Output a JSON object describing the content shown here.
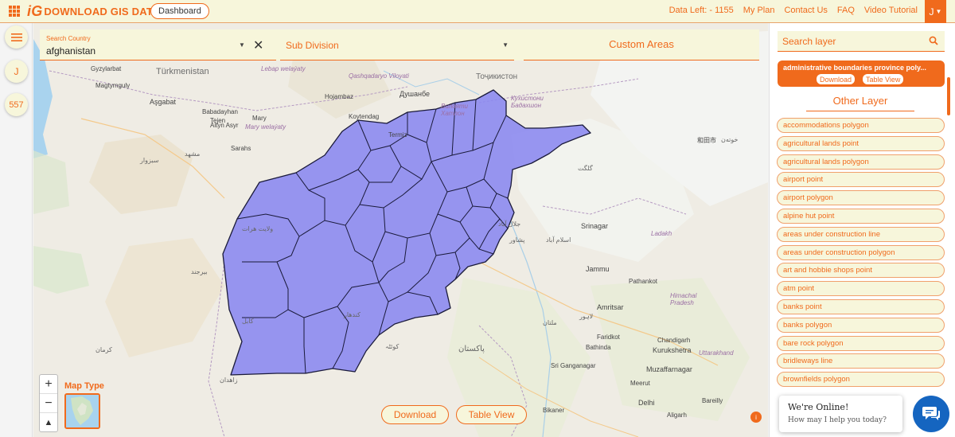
{
  "header": {
    "logo_mark": "iG",
    "logo_text": "DOWNLOAD GIS DATA",
    "dashboard": "Dashboard",
    "data_left": "Data Left: - 1155",
    "links": [
      "My Plan",
      "Contact Us",
      "FAQ",
      "Video Tutorial"
    ],
    "user_initial": "J"
  },
  "leftrail": {
    "user_initial": "J",
    "count": "557"
  },
  "search": {
    "country_label": "Search Country",
    "country_value": "afghanistan",
    "subdivision": "Sub Division",
    "custom_areas": "Custom Areas"
  },
  "map": {
    "map_type_label": "Map Type",
    "download_btn": "Download",
    "table_view_btn": "Table View",
    "zoom_in": "+",
    "zoom_out": "−",
    "reset_north": "▲",
    "labels": {
      "gyzylarbat": "Gyzylarbat",
      "turkmenistan": "Türkmenistan",
      "magtymguly": "Magtymguly",
      "ashgabat": "Aşgabat",
      "babadayhan": "Babadayhan",
      "tejen": "Tejen",
      "altyn_asyr": "Altyn Asyr",
      "mary": "Mary",
      "mary_welayaty": "Mary welaýaty",
      "sarahs": "Sarahs",
      "lebap": "Lebap welaýaty",
      "qashqadaryo": "Qashqadaryo Viloyati",
      "hojambaz": "Hojambaz",
      "koytendag": "Koytendag",
      "termiz": "Termiz",
      "dushanbe": "Душанбе",
      "tojikiston": "Тоҷикистон",
      "khatlon": "Вилояти Хатлон",
      "gbao": "Кухистони Бадахшон",
      "srinagar": "Srinagar",
      "ladakh": "Ladakh",
      "jammu": "Jammu",
      "pathankot": "Pathankot",
      "amritsar": "Amritsar",
      "himachal": "Himachal Pradesh",
      "faridkot": "Faridkot",
      "bathinda": "Bathinda",
      "kurukshetra": "Kurukshetra",
      "chandigarh": "Chandigarh",
      "uttarakhand": "Uttarakhand",
      "sri_ganganagar": "Sri Ganganagar",
      "muzaffarnagar": "Muzaffarnagar",
      "delhi": "Delhi",
      "bareilly": "Bareilly",
      "bikaner": "Bikaner",
      "aligarh": "Aligarh",
      "meerut": "Meerut",
      "hetian": "和田市",
      "pakistan": "پاکستان",
      "kandahar": "کندهار",
      "hotan_ug": "خوتەن",
      "herat_ar": "ولایت هرات",
      "kerman": "کرمان",
      "zahedan": "زاهدان",
      "mashhad": "مشهد",
      "kabul": "کابل",
      "quetta": "کوئٹہ",
      "peshawar": "پشاور",
      "islamabad": "اسلام آباد",
      "lahore": "لاہور",
      "multan": "ملتان",
      "jalalabad": "جلال آباد",
      "birjand": "بیرجند",
      "sabzevar": "سبزوار",
      "chitral": "گلگت"
    }
  },
  "rightpanel": {
    "search_placeholder": "Search layer",
    "active_layer_name": "administrative boundaries province poly...",
    "active_download": "Download",
    "active_table_view": "Table View",
    "other_layer_title": "Other Layer",
    "layers": [
      "accommodations polygon",
      "agricultural lands point",
      "agricultural lands polygon",
      "airport point",
      "airport polygon",
      "alpine hut point",
      "areas under construction line",
      "areas under construction polygon",
      "art and hobbie shops point",
      "atm point",
      "banks point",
      "banks polygon",
      "bare rock polygon",
      "bridleways line",
      "brownfields polygon"
    ]
  },
  "chat": {
    "title": "We're Online!",
    "subtitle": "How may I help you today?"
  },
  "colors": {
    "accent": "#f06a1c",
    "panel_bg": "#f7f6db",
    "country_fill": "#8a87f0",
    "chat_blue": "#1565c0"
  }
}
